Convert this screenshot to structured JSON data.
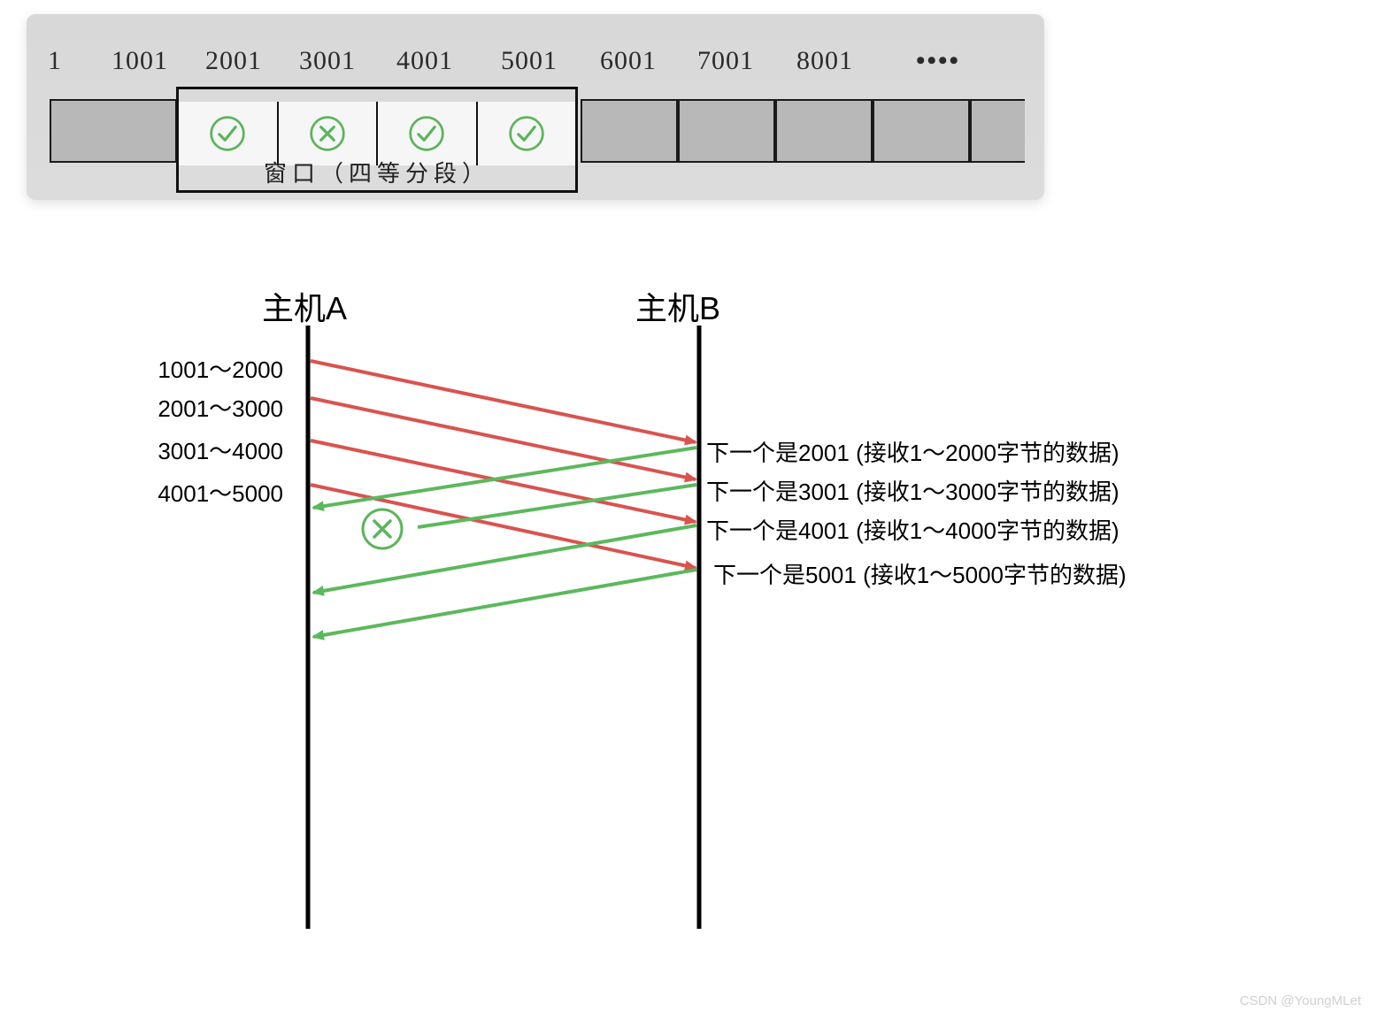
{
  "sequence_numbers": [
    "1",
    "1001",
    "2001",
    "3001",
    "4001",
    "5001",
    "6001",
    "7001",
    "8001",
    "••••"
  ],
  "window_label": "窗口（四等分段）",
  "window_cell_status": [
    "check",
    "cross",
    "check",
    "check"
  ],
  "host_a": "主机A",
  "host_b": "主机B",
  "send_ranges": [
    "1001～2000",
    "2001～3000",
    "3001～4000",
    "4001～5000"
  ],
  "ack_messages": [
    "下一个是2001 (接收1～2000字节的数据)",
    "下一个是3001 (接收1～3000字节的数据)",
    "下一个是4001 (接收1～4000字节的数据)",
    "下一个是5001 (接收1～5000字节的数据)"
  ],
  "watermark": "CSDN @YoungMLet",
  "colors": {
    "send_arrow": "#d9534f",
    "ack_arrow": "#5cb85c",
    "icon_green": "#5cb45c",
    "timeline": "#000000"
  },
  "chart_data": {
    "type": "sequence_diagram",
    "window_size_bytes": 4000,
    "segment_size_bytes": 1000,
    "segments_sent": [
      {
        "from": 1001,
        "to": 2000,
        "lost": false
      },
      {
        "from": 2001,
        "to": 3000,
        "lost": false
      },
      {
        "from": 3001,
        "to": 4000,
        "lost": false
      },
      {
        "from": 4001,
        "to": 5000,
        "lost": false
      }
    ],
    "acks": [
      {
        "next_seq": 2001,
        "received_range": [
          1,
          2000
        ],
        "lost": false
      },
      {
        "next_seq": 3001,
        "received_range": [
          1,
          3000
        ],
        "lost": true
      },
      {
        "next_seq": 4001,
        "received_range": [
          1,
          4000
        ],
        "lost": false
      },
      {
        "next_seq": 5001,
        "received_range": [
          1,
          5000
        ],
        "lost": false
      }
    ]
  }
}
